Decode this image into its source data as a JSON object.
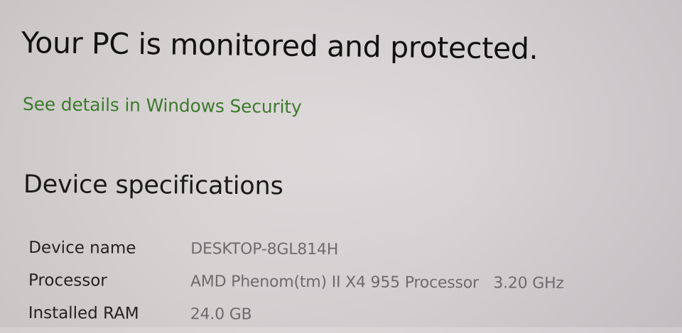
{
  "security": {
    "status_heading": "Your PC is monitored and protected.",
    "details_link": "See details in Windows Security"
  },
  "device_specifications": {
    "heading": "Device specifications",
    "rows": [
      {
        "label": "Device name",
        "value": "DESKTOP-8GL814H"
      },
      {
        "label": "Processor",
        "value": "AMD Phenom(tm) II X4 955 Processor   3.20 GHz"
      },
      {
        "label": "Installed RAM",
        "value": "24.0 GB"
      }
    ]
  }
}
